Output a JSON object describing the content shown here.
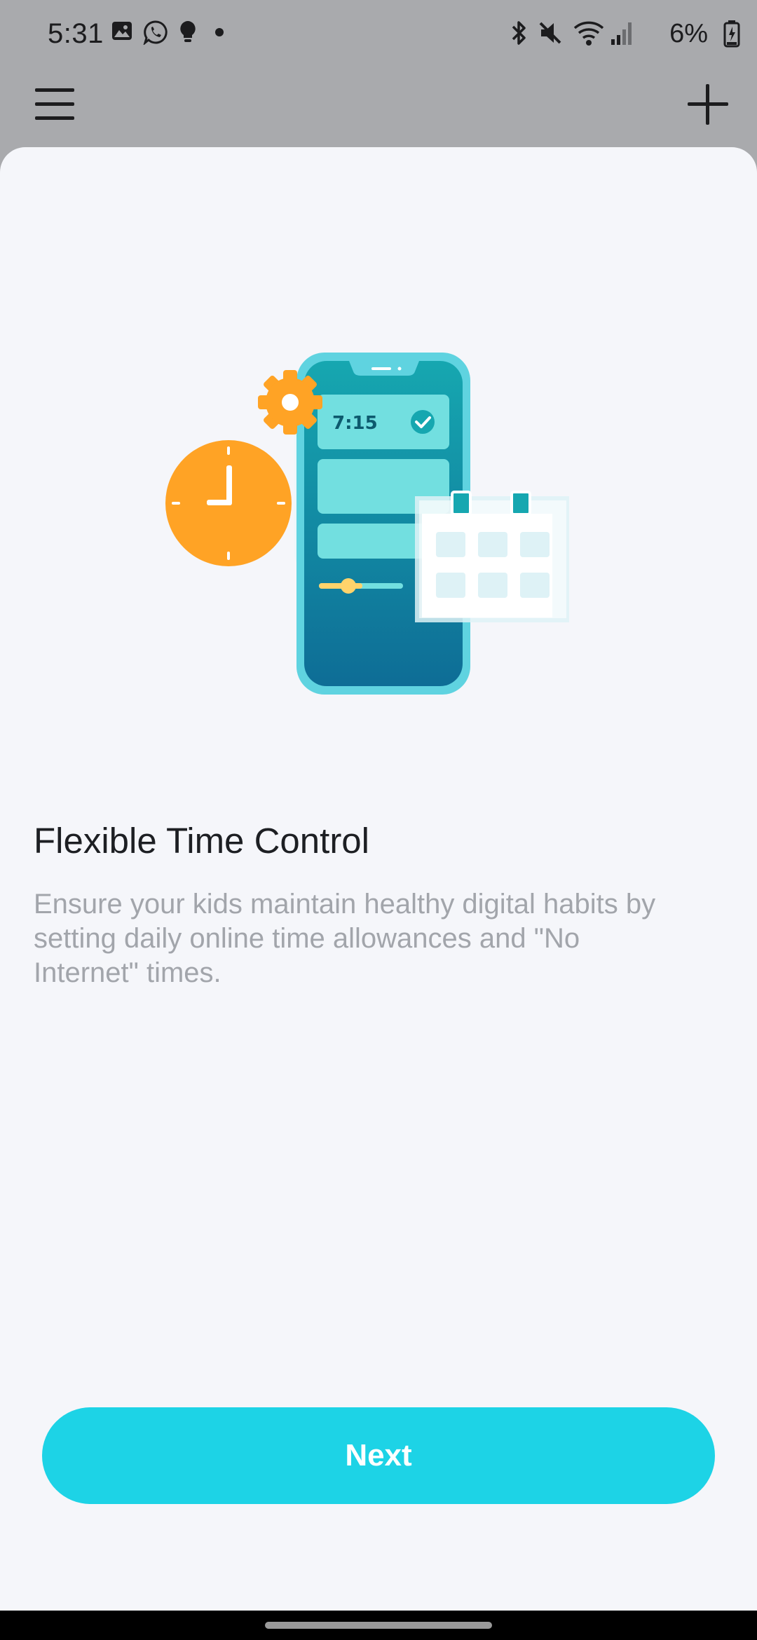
{
  "status_bar": {
    "time": "5:31",
    "left_icons": [
      "gallery-icon",
      "whatsapp-icon",
      "bulb-icon",
      "dot-icon"
    ],
    "right_icons": [
      "bluetooth-icon",
      "mute-icon",
      "wifi-icon",
      "signal-icon",
      "battery-icon"
    ],
    "battery": "6%"
  },
  "toolbar": {
    "menu_icon": "hamburger-menu-icon",
    "add_icon": "plus-icon"
  },
  "illustration": {
    "phone_time": "7:15",
    "colors": {
      "orange": "#ffa325",
      "teal_dark": "#0e7399",
      "teal": "#16a7b0",
      "teal_light": "#72dfe0",
      "cyan_edge": "#5fd3e0"
    }
  },
  "onboarding": {
    "title": "Flexible Time Control",
    "description": "Ensure your kids maintain healthy digital habits by setting daily online time allowances and \"No Internet\" times.",
    "next_label": "Next"
  },
  "colors": {
    "accent": "#1dd3e6",
    "sheet_bg": "#f5f6fa",
    "scrim": "#a9aaad"
  }
}
